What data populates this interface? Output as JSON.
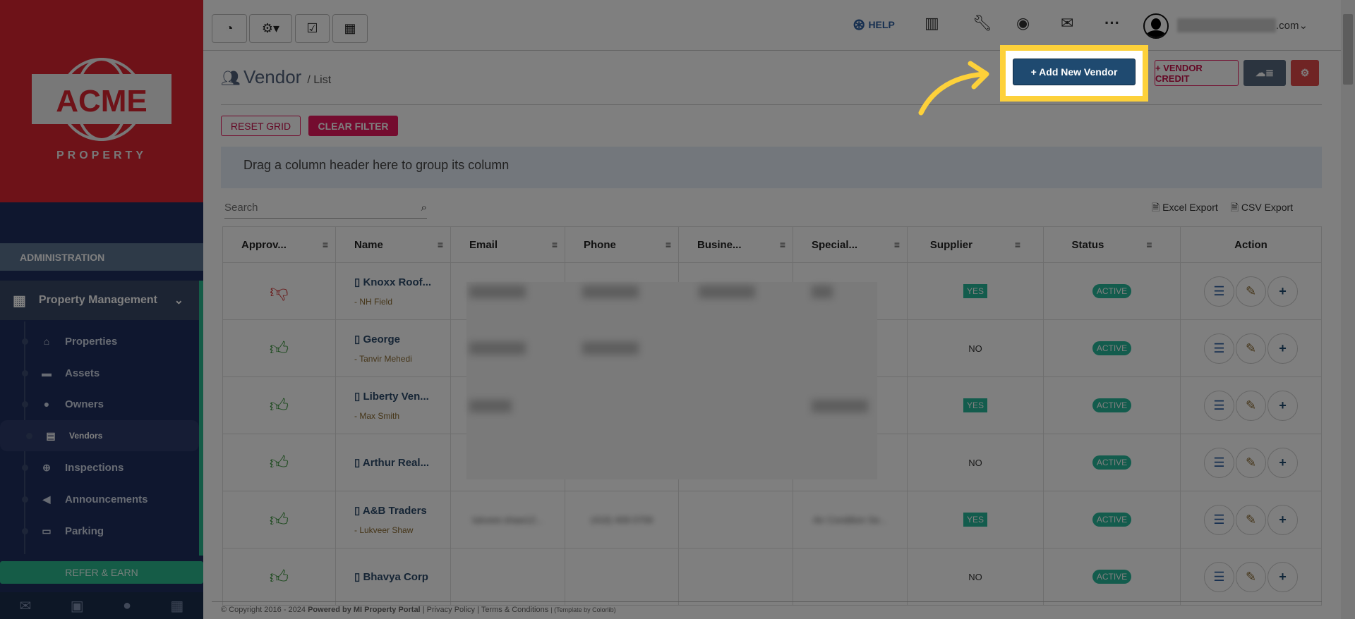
{
  "logo": {
    "brand": "ACME",
    "sub": "PROPERTY"
  },
  "sidebar": {
    "section": "ADMINISTRATION",
    "group": "Property Management",
    "items": [
      {
        "label": "Properties",
        "icon": "home-icon",
        "glyph": "⌂"
      },
      {
        "label": "Assets",
        "icon": "archive-icon",
        "glyph": "▬"
      },
      {
        "label": "Owners",
        "icon": "user-icon",
        "glyph": "●"
      },
      {
        "label": "Vendors",
        "icon": "briefcase-icon",
        "glyph": "▤"
      },
      {
        "label": "Inspections",
        "icon": "zoom-in-icon",
        "glyph": "⊕"
      },
      {
        "label": "Announcements",
        "icon": "bullhorn-icon",
        "glyph": "◀"
      },
      {
        "label": "Parking",
        "icon": "car-icon",
        "glyph": "▭"
      }
    ],
    "refer": "REFER & EARN"
  },
  "header": {
    "help": "HELP",
    "user_email_suffix": ".com"
  },
  "page": {
    "title": "Vendor",
    "crumb": "/ List",
    "add_vendor": "+ Add New Vendor",
    "vendor_credit": "+ VENDOR CREDIT",
    "reset_grid": "RESET GRID",
    "clear_filter": "CLEAR FILTER"
  },
  "grid": {
    "group_hint": "Drag a column header here to group its column",
    "search_placeholder": "Search",
    "excel": "Excel Export",
    "csv": "CSV Export",
    "columns": [
      "Approv...",
      "Name",
      "Email",
      "Phone",
      "Busine...",
      "Special...",
      "Supplier",
      "Status",
      "Action"
    ],
    "rows": [
      {
        "approved": false,
        "name": "Knoxx Roof...",
        "contact": "- NH Field",
        "supplier": "YES",
        "status": "ACTIVE"
      },
      {
        "approved": true,
        "name": "George",
        "contact": "- Tanvir Mehedi",
        "supplier": "NO",
        "status": "ACTIVE"
      },
      {
        "approved": true,
        "name": "Liberty Ven...",
        "contact": "- Max Smith",
        "supplier": "YES",
        "status": "ACTIVE"
      },
      {
        "approved": true,
        "name": "Arthur Real...",
        "contact": "",
        "supplier": "NO",
        "status": "ACTIVE"
      },
      {
        "approved": true,
        "name": "A&B Traders",
        "contact": "- Lukveer Shaw",
        "email": "lukveer.shaw12...",
        "phone": "(416) 409 0709",
        "special": "Air Condition Se...",
        "supplier": "YES",
        "status": "ACTIVE"
      },
      {
        "approved": true,
        "name": "Bhavya Corp",
        "contact": "",
        "supplier": "NO",
        "status": "ACTIVE"
      }
    ]
  },
  "footer": {
    "copyright": "© Copyright 2016 - 2024",
    "powered": "Powered by MI Property Portal",
    "privacy": "| Privacy Policy",
    "terms": "| Terms & Conditions",
    "template": "| (Template by Colorlib)"
  },
  "colors": {
    "highlight": "#fdd13a",
    "primary": "#1f4a70",
    "accent": "#e8185e"
  }
}
